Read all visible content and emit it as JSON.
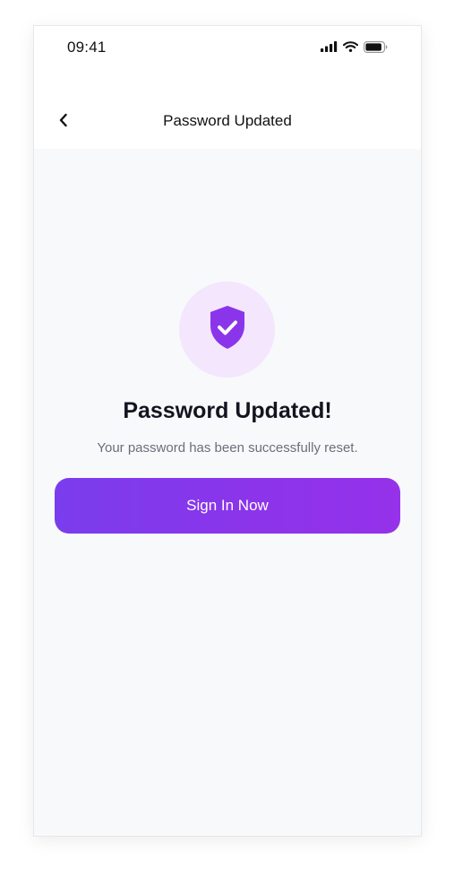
{
  "status_bar": {
    "time": "09:41",
    "icons": [
      "signal-icon",
      "wifi-icon",
      "battery-icon"
    ]
  },
  "nav": {
    "back_icon": "chevron-left-icon",
    "title": "Password Updated"
  },
  "success": {
    "icon": "shield-check-icon",
    "headline": "Password Updated!",
    "message": "Your password has been successfully reset."
  },
  "actions": {
    "primary_label": "Sign In Now"
  },
  "colors": {
    "accent": "#8b35ea",
    "accent_gradient_start": "#7a3ded",
    "accent_gradient_end": "#9532ea",
    "badge_background": "#f3e6fd",
    "screen_background": "#f8f9fb",
    "header_background": "#ffffff"
  }
}
